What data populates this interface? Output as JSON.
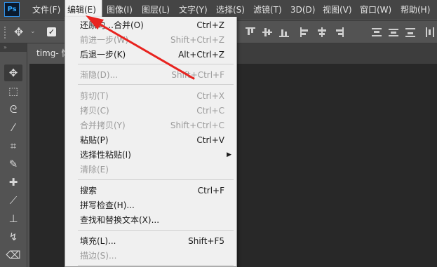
{
  "app": {
    "logo": "Ps"
  },
  "menubar": {
    "items": [
      {
        "label": "文件(F)"
      },
      {
        "label": "编辑(E)"
      },
      {
        "label": "图像(I)"
      },
      {
        "label": "图层(L)"
      },
      {
        "label": "文字(Y)"
      },
      {
        "label": "选择(S)"
      },
      {
        "label": "滤镜(T)"
      },
      {
        "label": "3D(D)"
      },
      {
        "label": "视图(V)"
      },
      {
        "label": "窗口(W)"
      },
      {
        "label": "帮助(H)"
      }
    ],
    "active_index": 1
  },
  "options_bar": {
    "move_icon": "move-icon",
    "checkbox_checked": true
  },
  "tools_panel": {
    "collapse_label": "»"
  },
  "document": {
    "tab_title": "timg- 恢"
  },
  "edit_menu": {
    "items": [
      {
        "label": "还原向…合并(O)",
        "shortcut": "Ctrl+Z",
        "disabled": false
      },
      {
        "label": "前进一步(W)",
        "shortcut": "Shift+Ctrl+Z",
        "disabled": true
      },
      {
        "label": "后退一步(K)",
        "shortcut": "Alt+Ctrl+Z",
        "disabled": false
      },
      {
        "label": "渐隐(D)...",
        "shortcut": "Shift+Ctrl+F",
        "disabled": true
      },
      {
        "label": "剪切(T)",
        "shortcut": "Ctrl+X",
        "disabled": true
      },
      {
        "label": "拷贝(C)",
        "shortcut": "Ctrl+C",
        "disabled": true
      },
      {
        "label": "合并拷贝(Y)",
        "shortcut": "Shift+Ctrl+C",
        "disabled": true
      },
      {
        "label": "粘贴(P)",
        "shortcut": "Ctrl+V",
        "disabled": false
      },
      {
        "label": "选择性粘贴(I)",
        "shortcut": "",
        "disabled": false,
        "submenu": true
      },
      {
        "label": "清除(E)",
        "shortcut": "",
        "disabled": true
      },
      {
        "label": "搜索",
        "shortcut": "Ctrl+F",
        "disabled": false
      },
      {
        "label": "拼写检查(H)...",
        "shortcut": "",
        "disabled": false
      },
      {
        "label": "查找和替换文本(X)...",
        "shortcut": "",
        "disabled": false
      },
      {
        "label": "填充(L)...",
        "shortcut": "Shift+F5",
        "disabled": false
      },
      {
        "label": "描边(S)...",
        "shortcut": "",
        "disabled": true
      }
    ]
  },
  "colors": {
    "annotation_arrow": "#e8231f",
    "menu_bg": "#f0f0f0",
    "app_bg": "#535353"
  }
}
